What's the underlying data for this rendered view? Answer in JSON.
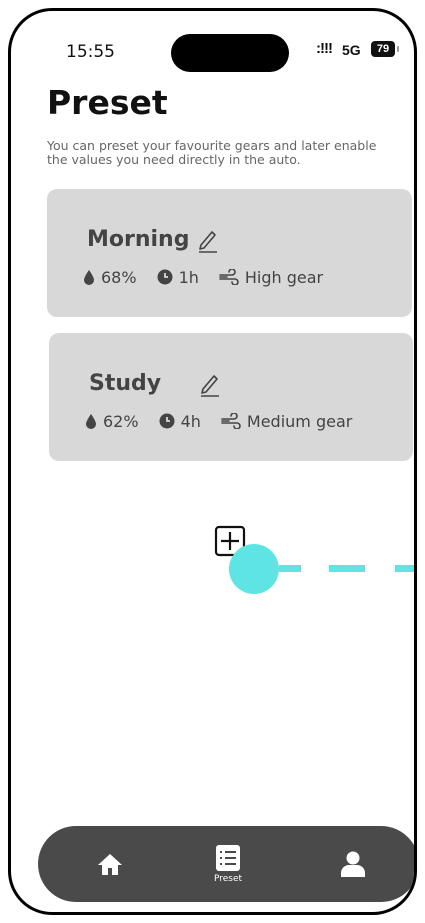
{
  "status_bar": {
    "time": "15:55",
    "signal": ":!!!",
    "network": "5G",
    "battery": "79"
  },
  "page": {
    "title": "Preset",
    "description": "You can preset your favourite gears and later enable the values you need directly in the auto."
  },
  "presets": [
    {
      "name": "Morning",
      "humidity": "68%",
      "duration": "1h",
      "gear": "High gear"
    },
    {
      "name": "Study",
      "humidity": "62%",
      "duration": "4h",
      "gear": "Medium gear"
    }
  ],
  "nav": {
    "items": [
      {
        "icon": "home-icon",
        "label": ""
      },
      {
        "icon": "list-icon",
        "label": "Preset"
      },
      {
        "icon": "user-icon",
        "label": ""
      }
    ]
  },
  "colors": {
    "card": "#d8d8d8",
    "nav": "#4a4a4a",
    "cursor": "#5ee5e3",
    "text": "#444444"
  }
}
